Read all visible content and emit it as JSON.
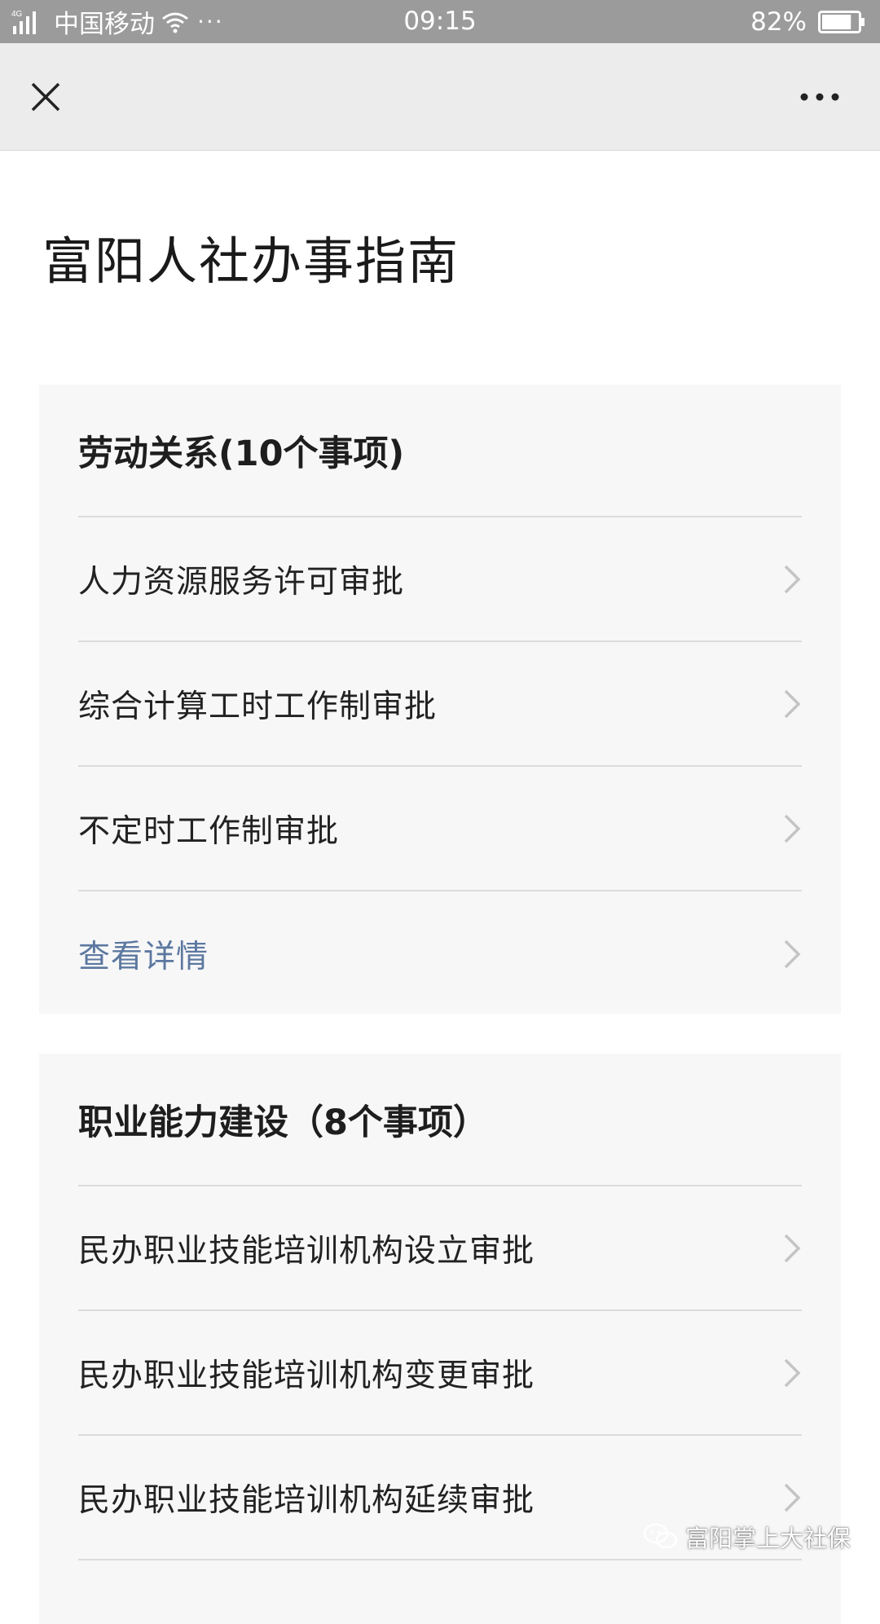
{
  "status_bar": {
    "network": "4G",
    "carrier": "中国移动",
    "dots": "···",
    "time": "09:15",
    "battery": "82%",
    "battery_level": 0.82
  },
  "nav": {
    "close_icon": "close-icon",
    "more_icon": "more-dots-icon"
  },
  "page": {
    "title": "富阳人社办事指南"
  },
  "sections": [
    {
      "header": "劳动关系(10个事项)",
      "items": [
        "人力资源服务许可审批",
        "综合计算工时工作制审批",
        "不定时工作制审批"
      ],
      "details": "查看详情"
    },
    {
      "header": "职业能力建设（8个事项）",
      "items": [
        "民办职业技能培训机构设立审批",
        "民办职业技能培训机构变更审批",
        "民办职业技能培训机构延续审批"
      ]
    }
  ],
  "watermark": {
    "text": "富阳掌上大社保"
  },
  "colors": {
    "status_bar": "#9b9b9b",
    "nav_bar": "#ececec",
    "card_bg": "#f7f7f7",
    "link": "#5c78a0"
  }
}
